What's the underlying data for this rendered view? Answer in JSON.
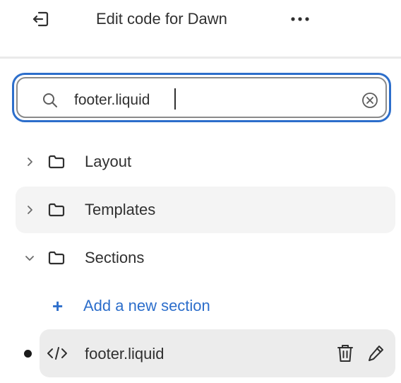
{
  "header": {
    "title": "Edit code for Dawn",
    "exit_icon": "exit-icon",
    "more_icon": "more-horizontal-icon"
  },
  "search": {
    "value": "footer.liquid",
    "icon": "search-icon",
    "clear_icon": "clear-circle-icon",
    "focus_color": "#2c6ecb"
  },
  "tree": {
    "folders": [
      {
        "label": "Layout",
        "expanded": false
      },
      {
        "label": "Templates",
        "expanded": false
      },
      {
        "label": "Sections",
        "expanded": true
      }
    ],
    "add_section_label": "Add a new section",
    "accent_color": "#2c6ecb",
    "file": {
      "label": "footer.liquid",
      "icon": "code-icon",
      "modified": true,
      "actions": [
        "trash-icon",
        "pencil-icon"
      ]
    }
  }
}
